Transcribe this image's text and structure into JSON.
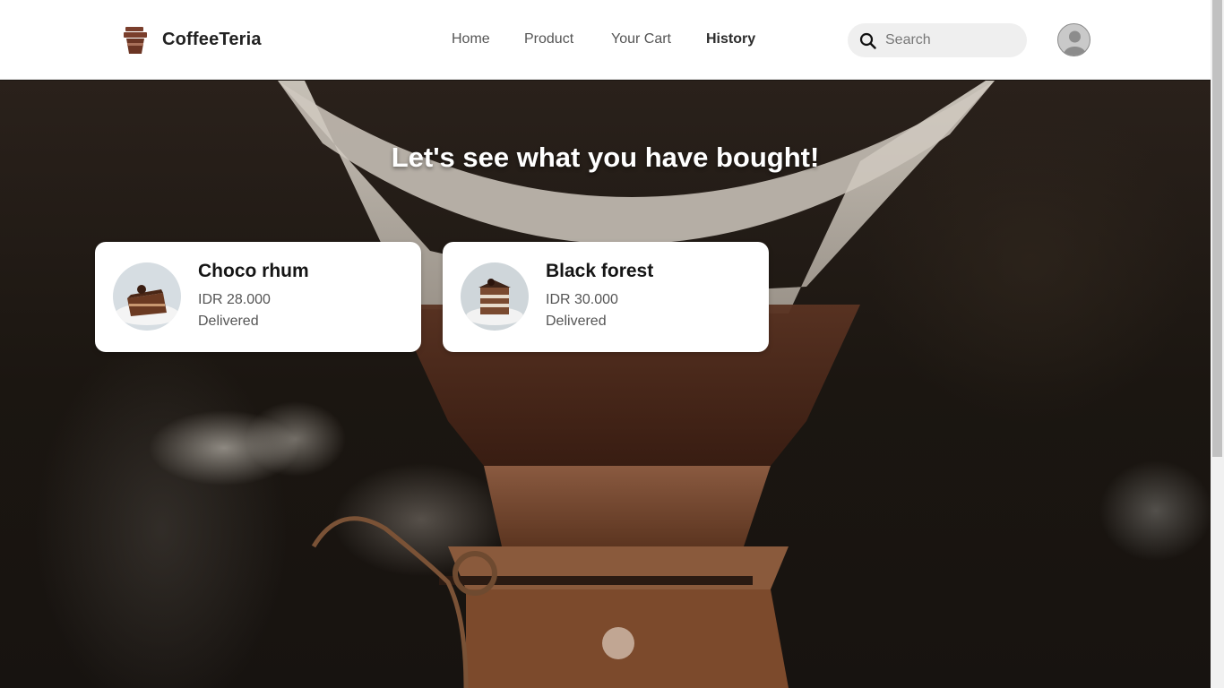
{
  "brand": {
    "name": "CoffeeTeria",
    "icon": "coffee-cup-icon"
  },
  "nav": [
    {
      "label": "Home",
      "active": false
    },
    {
      "label": "Product",
      "active": false
    },
    {
      "label": "Your Cart",
      "active": false
    },
    {
      "label": "History",
      "active": true
    }
  ],
  "search": {
    "placeholder": "Search",
    "icon": "search-icon"
  },
  "hero": {
    "title": "Let's see what you have bought!"
  },
  "orders": [
    {
      "name": "Choco rhum",
      "price": "IDR 28.000",
      "status": "Delivered"
    },
    {
      "name": "Black forest",
      "price": "IDR 30.000",
      "status": "Delivered"
    }
  ],
  "colors": {
    "brand": "#6b3a2a",
    "header_bg": "#ffffff",
    "card_bg": "#ffffff"
  }
}
